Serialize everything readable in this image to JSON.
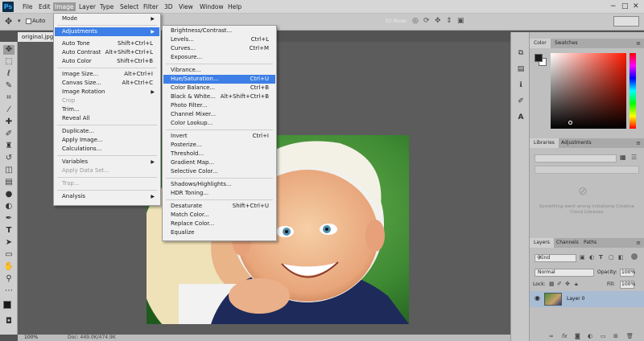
{
  "app": {
    "logo": "Ps"
  },
  "menubar": [
    "File",
    "Edit",
    "Image",
    "Layer",
    "Type",
    "Select",
    "Filter",
    "3D",
    "View",
    "Window",
    "Help"
  ],
  "window_controls": [
    "−",
    "□",
    "✕"
  ],
  "options_bar": {
    "auto_select": "Auto",
    "mode_3d": "3D Mode:"
  },
  "document": {
    "tab": "original.jpg",
    "zoom": "100%",
    "info": "Doc: 449.0K/474.9K"
  },
  "image_menu": [
    {
      "label": "Mode",
      "submenu": true
    },
    {
      "label": "Adjustments",
      "submenu": true,
      "highlighted": true
    },
    {
      "label": "Auto Tone",
      "shortcut": "Shift+Ctrl+L"
    },
    {
      "label": "Auto Contrast",
      "shortcut": "Alt+Shift+Ctrl+L"
    },
    {
      "label": "Auto Color",
      "shortcut": "Shift+Ctrl+B"
    },
    {
      "label": "Image Size...",
      "shortcut": "Alt+Ctrl+I"
    },
    {
      "label": "Canvas Size...",
      "shortcut": "Alt+Ctrl+C"
    },
    {
      "label": "Image Rotation",
      "submenu": true
    },
    {
      "label": "Crop",
      "disabled": true
    },
    {
      "label": "Trim..."
    },
    {
      "label": "Reveal All"
    },
    {
      "label": "Duplicate..."
    },
    {
      "label": "Apply Image..."
    },
    {
      "label": "Calculations..."
    },
    {
      "label": "Variables",
      "submenu": true
    },
    {
      "label": "Apply Data Set...",
      "disabled": true
    },
    {
      "label": "Trap...",
      "disabled": true
    },
    {
      "label": "Analysis",
      "submenu": true
    }
  ],
  "adjustments_menu": [
    {
      "label": "Brightness/Contrast..."
    },
    {
      "label": "Levels...",
      "shortcut": "Ctrl+L"
    },
    {
      "label": "Curves...",
      "shortcut": "Ctrl+M"
    },
    {
      "label": "Exposure..."
    },
    {
      "label": "Vibrance..."
    },
    {
      "label": "Hue/Saturation...",
      "shortcut": "Ctrl+U",
      "highlighted": true
    },
    {
      "label": "Color Balance...",
      "shortcut": "Ctrl+B"
    },
    {
      "label": "Black & White...",
      "shortcut": "Alt+Shift+Ctrl+B"
    },
    {
      "label": "Photo Filter..."
    },
    {
      "label": "Channel Mixer..."
    },
    {
      "label": "Color Lookup..."
    },
    {
      "label": "Invert",
      "shortcut": "Ctrl+I"
    },
    {
      "label": "Posterize..."
    },
    {
      "label": "Threshold..."
    },
    {
      "label": "Gradient Map..."
    },
    {
      "label": "Selective Color..."
    },
    {
      "label": "Shadows/Highlights..."
    },
    {
      "label": "HDR Toning..."
    },
    {
      "label": "Desaturate",
      "shortcut": "Shift+Ctrl+U"
    },
    {
      "label": "Match Color..."
    },
    {
      "label": "Replace Color..."
    },
    {
      "label": "Equalize"
    }
  ],
  "color_panel": {
    "tabs": [
      "Color",
      "Swatches"
    ],
    "foreground": "#1a1a1a",
    "background": "#ffffff"
  },
  "libraries_panel": {
    "tabs": [
      "Libraries",
      "Adjustments"
    ],
    "message": "Something went wrong initializing Creative Cloud Libraries"
  },
  "layers_panel": {
    "tabs": [
      "Layers",
      "Channels",
      "Paths"
    ],
    "filter": "Kind",
    "blend_mode": "Normal",
    "opacity_label": "Opacity:",
    "opacity": "100%",
    "lock_label": "Lock:",
    "fill_label": "Fill:",
    "fill": "100%",
    "layer_name": "Layer 0"
  }
}
